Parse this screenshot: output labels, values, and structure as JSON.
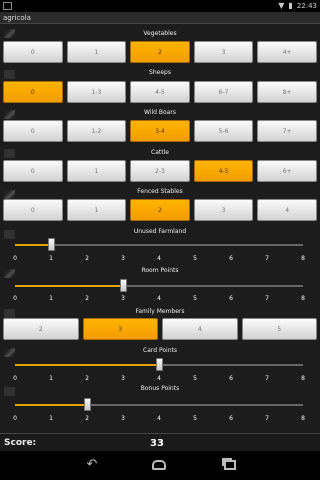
{
  "status": {
    "time": "22:43"
  },
  "app": {
    "title": "agricola"
  },
  "rows": [
    {
      "label": "Vegetables",
      "type": "buttons",
      "options": [
        "0",
        "1",
        "2",
        "3",
        "4+"
      ],
      "selected": 2
    },
    {
      "label": "Sheeps",
      "type": "buttons",
      "options": [
        "0",
        "1-3",
        "4-5",
        "6-7",
        "8+"
      ],
      "selected": 0
    },
    {
      "label": "Wild Boars",
      "type": "buttons",
      "options": [
        "0",
        "1-2",
        "3-4",
        "5-6",
        "7+"
      ],
      "selected": 2
    },
    {
      "label": "Cattle",
      "type": "buttons",
      "options": [
        "0",
        "1",
        "2-3",
        "4-5",
        "6+"
      ],
      "selected": 3
    },
    {
      "label": "Fenced Stables",
      "type": "buttons",
      "options": [
        "0",
        "1",
        "2",
        "3",
        "4"
      ],
      "selected": 2
    },
    {
      "label": "Unused Farmland",
      "type": "slider",
      "ticks": [
        "0",
        "1",
        "2",
        "3",
        "4",
        "5",
        "6",
        "7",
        "8"
      ],
      "value": 1
    },
    {
      "label": "Room Points",
      "type": "slider",
      "ticks": [
        "0",
        "1",
        "2",
        "3",
        "4",
        "5",
        "6",
        "7",
        "8"
      ],
      "value": 3
    },
    {
      "label": "Family Members",
      "type": "buttons",
      "options": [
        "2",
        "3",
        "4",
        "5"
      ],
      "selected": 1
    },
    {
      "label": "Card Points",
      "type": "slider",
      "ticks": [
        "0",
        "1",
        "2",
        "3",
        "4",
        "5",
        "6",
        "7",
        "8"
      ],
      "value": 4
    },
    {
      "label": "Bonus Points",
      "type": "slider",
      "ticks": [
        "0",
        "1",
        "2",
        "3",
        "4",
        "5",
        "6",
        "7",
        "8"
      ],
      "value": 2
    }
  ],
  "score": {
    "label": "Score:",
    "value": "33"
  },
  "colors": {
    "selected": "#f39c00",
    "background": "#1c1c1c"
  },
  "nav": {
    "back_icon": "back-arrow-icon",
    "home_icon": "home-icon",
    "recent_icon": "recent-apps-icon"
  }
}
